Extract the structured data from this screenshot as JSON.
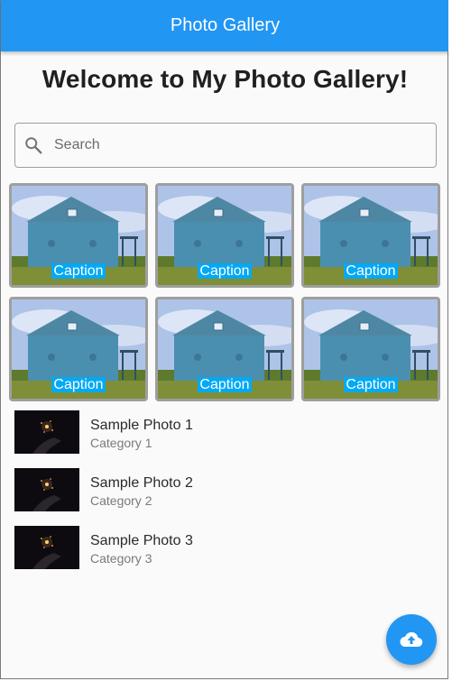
{
  "appbar": {
    "title": "Photo Gallery"
  },
  "welcome": "Welcome to My Photo Gallery!",
  "search": {
    "placeholder": "Search",
    "icon": "search-icon"
  },
  "gallery": {
    "tiles": [
      {
        "caption": "Caption"
      },
      {
        "caption": "Caption"
      },
      {
        "caption": "Caption"
      },
      {
        "caption": "Caption"
      },
      {
        "caption": "Caption"
      },
      {
        "caption": "Caption"
      }
    ]
  },
  "photos": [
    {
      "title": "Sample Photo 1",
      "category": "Category 1"
    },
    {
      "title": "Sample Photo 2",
      "category": "Category 2"
    },
    {
      "title": "Sample Photo 3",
      "category": "Category 3"
    }
  ],
  "fab": {
    "icon": "cloud-upload-icon"
  },
  "colors": {
    "primary": "#2196f3",
    "caption_bg": "#03a9f4",
    "tile_border": "#9e9e9e"
  }
}
